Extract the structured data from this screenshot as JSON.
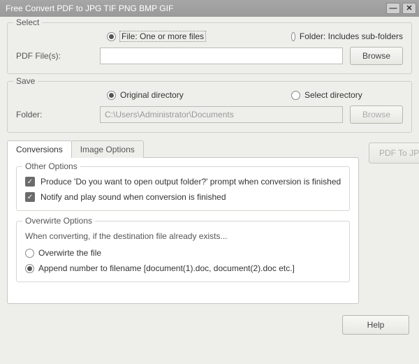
{
  "window": {
    "title": "Free Convert PDF to JPG TIF PNG BMP GIF"
  },
  "select": {
    "legend": "Select",
    "radio_file": "File:  One or more files",
    "radio_folder": "Folder: Includes sub-folders",
    "pdf_label": "PDF File(s):",
    "pdf_value": "",
    "browse": "Browse"
  },
  "save": {
    "legend": "Save",
    "radio_original": "Original directory",
    "radio_select": "Select directory",
    "folder_label": "Folder:",
    "folder_value": "C:\\Users\\Administrator\\Documents",
    "browse": "Browse"
  },
  "tabs": {
    "conversions": "Conversions",
    "image_options": "Image Options"
  },
  "other_options": {
    "legend": "Other Options",
    "produce_prompt": "Produce 'Do you want to open output folder?' prompt when conversion is finished",
    "notify": "Notify and play sound when conversion is finished"
  },
  "overwrite": {
    "legend": "Overwirte Options",
    "desc": "When converting, if the destination file already exists...",
    "opt_overwrite": "Overwirte the file",
    "opt_append": "Append number to filename  [document(1).doc, document(2).doc etc.]"
  },
  "actions": {
    "pdf_to_jpg": "PDF To JPG",
    "help": "Help"
  }
}
